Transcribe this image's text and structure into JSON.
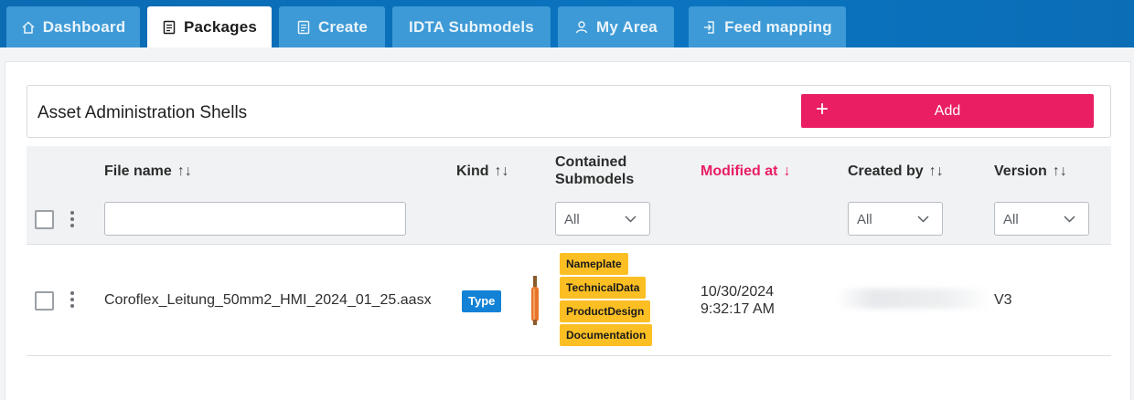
{
  "tabs": [
    {
      "label": "Dashboard",
      "icon": "home-icon",
      "active": false
    },
    {
      "label": "Packages",
      "icon": "document-icon",
      "active": true
    },
    {
      "label": "Create",
      "icon": "document-icon",
      "active": false
    },
    {
      "label": "IDTA Submodels",
      "icon": "",
      "active": false
    },
    {
      "label": "My Area",
      "icon": "user-icon",
      "active": false
    },
    {
      "label": "Feed mapping",
      "icon": "feed-icon",
      "active": false
    }
  ],
  "shells": {
    "title": "Asset Administration Shells",
    "add_label": "Add",
    "add_icon": "+"
  },
  "table": {
    "columns": {
      "file_name": "File name",
      "kind": "Kind",
      "submodels_line1": "Contained",
      "submodels_line2": "Submodels",
      "modified": "Modified at",
      "created_by": "Created by",
      "version": "Version"
    },
    "sort_arrows": "↑↓",
    "sorted_arrow": "↓",
    "filters": {
      "file_name": "",
      "submodels": "All",
      "created_by": "All",
      "version": "All"
    },
    "rows": [
      {
        "file_name": "Coroflex_Leitung_50mm2_HMI_2024_01_25.aasx",
        "kind": "Type",
        "submodels": [
          "Nameplate",
          "TechnicalData",
          "ProductDesign",
          "Documentation"
        ],
        "modified_date": "10/30/2024",
        "modified_time": "9:32:17 AM",
        "created_by": "",
        "version": "V3"
      }
    ]
  },
  "colors": {
    "topbar": "#0a74c0",
    "tab_inactive": "#3d9ad6",
    "accent": "#e91e63",
    "badge_type": "#1281d6",
    "submodel_badge": "#fbbf24"
  }
}
